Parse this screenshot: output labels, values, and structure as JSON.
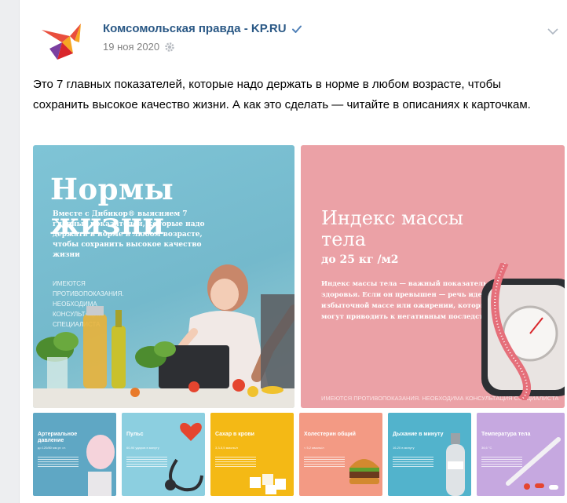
{
  "post": {
    "author": "Комсомольская правда - KP.RU",
    "date": "19 ноя 2020",
    "text": "Это 7 главных показателей, которые надо держать в норме в любом возрасте, чтобы сохранить высокое качество жизни. А как это сделать — читайте в описаниях к карточкам."
  },
  "cards": {
    "main": {
      "title": "Нормы жизни",
      "desc": "Вместе с Дибикор® выясняем 7 главных показателей, которые надо держать в норме в любом возрасте, чтобы сохранить высокое качество жизни",
      "warning": "Имеются противопоказания. Необходима консультация специалиста"
    },
    "bmi": {
      "title": "Индекс массы тела",
      "subtitle": "до 25 кг /м2",
      "desc": "Индекс массы тела — важный показатель здоровья. Если он превышен — речь идет об избыточной массе или ожирении, которые могут приводить к негативным последствиям",
      "warning": "Имеются противопоказания. Необходима консультация специалиста"
    },
    "thumbs": [
      {
        "title": "Артериальное давление",
        "sub": "до 120/80 мм рт. ст.",
        "color": "#5fa7c4"
      },
      {
        "title": "Пульс",
        "sub": "60-90 ударов в минуту",
        "color": "#8ccfe0"
      },
      {
        "title": "Сахар в крови",
        "sub": "3,3-5,5 ммоль/л",
        "color": "#f4b915"
      },
      {
        "title": "Холестерин общий",
        "sub": "< 5,2 ммоль/л",
        "color": "#f39a84"
      },
      {
        "title": "Дыхание в минуту",
        "sub": "16-20 в минуту",
        "color": "#52b3cc"
      },
      {
        "title": "Температура тела",
        "sub": "36,6 °С",
        "color": "#c6a8e0"
      }
    ]
  },
  "colors": {
    "link": "#2a5885",
    "date": "#828282",
    "blue_card": "#7fc4d6",
    "pink_card": "#eba1a6"
  },
  "icons": [
    "logo-bird-icon",
    "verified-icon",
    "gear-icon",
    "chevron-down-icon"
  ]
}
